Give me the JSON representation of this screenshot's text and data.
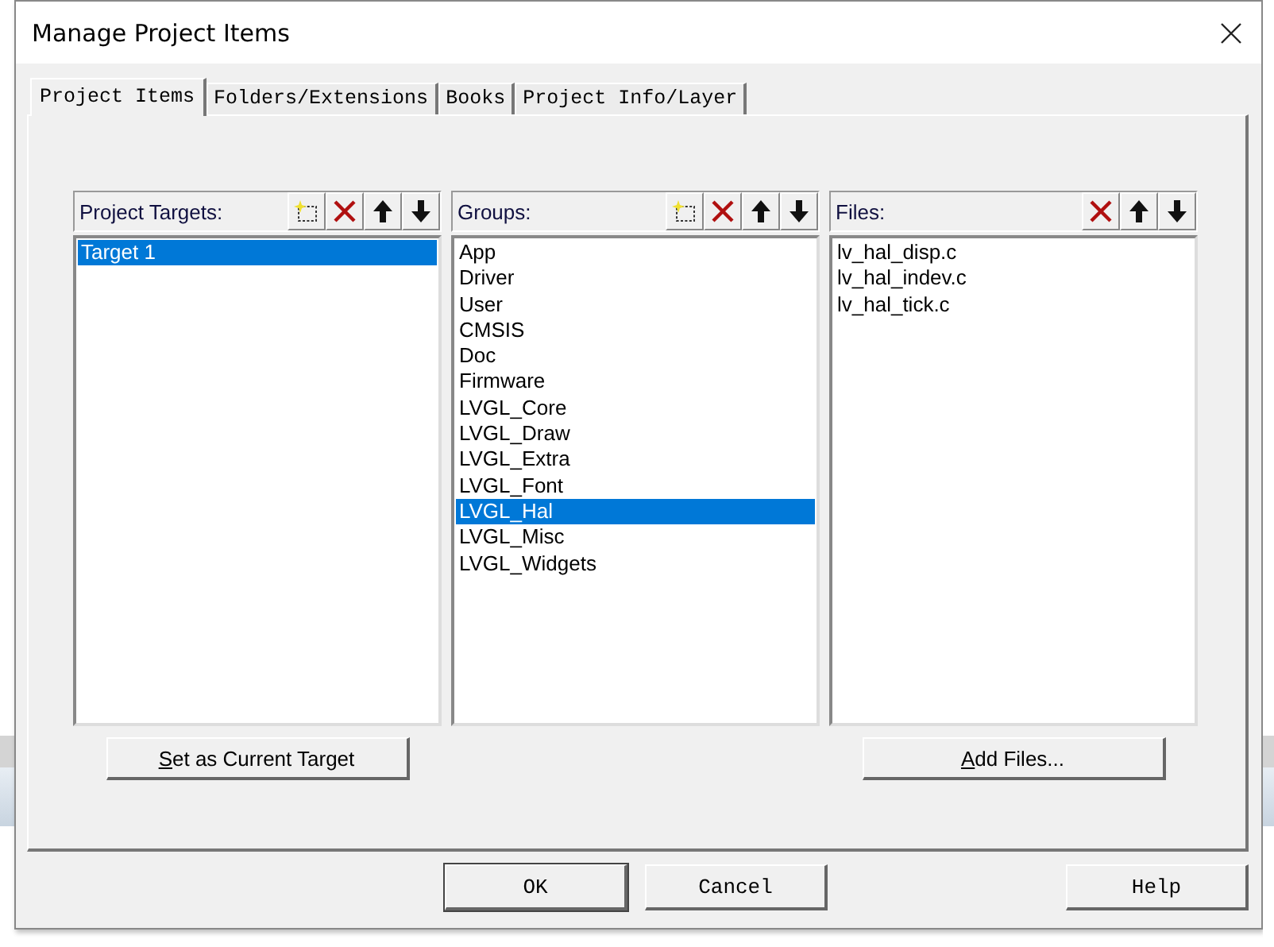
{
  "window": {
    "title": "Manage Project Items"
  },
  "tabs": [
    {
      "label": "Project Items",
      "selected": true
    },
    {
      "label": "Folders/Extensions",
      "selected": false
    },
    {
      "label": "Books",
      "selected": false
    },
    {
      "label": "Project Info/Layer",
      "selected": false
    }
  ],
  "panes": [
    {
      "title": "Project Targets:",
      "tools": [
        {
          "kind": "new"
        },
        {
          "kind": "delete"
        },
        {
          "kind": "up"
        },
        {
          "kind": "down"
        }
      ],
      "items": [
        {
          "label": "Target 1",
          "selected": true
        }
      ],
      "button": {
        "label": "Set as Current Target",
        "mnemonic_underlined": true
      }
    },
    {
      "title": "Groups:",
      "tools": [
        {
          "kind": "new"
        },
        {
          "kind": "delete"
        },
        {
          "kind": "up"
        },
        {
          "kind": "down"
        }
      ],
      "items": [
        {
          "label": "App",
          "selected": false
        },
        {
          "label": "Driver",
          "selected": false
        },
        {
          "label": "User",
          "selected": false
        },
        {
          "label": "CMSIS",
          "selected": false
        },
        {
          "label": "Doc",
          "selected": false
        },
        {
          "label": "Firmware",
          "selected": false
        },
        {
          "label": "LVGL_Core",
          "selected": false
        },
        {
          "label": "LVGL_Draw",
          "selected": false
        },
        {
          "label": "LVGL_Extra",
          "selected": false
        },
        {
          "label": "LVGL_Font",
          "selected": false
        },
        {
          "label": "LVGL_Hal",
          "selected": true
        },
        {
          "label": "LVGL_Misc",
          "selected": false
        },
        {
          "label": "LVGL_Widgets",
          "selected": false
        }
      ]
    },
    {
      "title": "Files:",
      "tools": [
        {
          "kind": "delete"
        },
        {
          "kind": "up"
        },
        {
          "kind": "down"
        }
      ],
      "items": [
        {
          "label": "lv_hal_disp.c",
          "selected": false
        },
        {
          "label": "lv_hal_indev.c",
          "selected": false
        },
        {
          "label": "lv_hal_tick.c",
          "selected": false
        }
      ],
      "button": {
        "label": "Add Files...",
        "mnemonic_underlined": true
      }
    }
  ],
  "buttons": [
    {
      "label": "OK",
      "kind": "ok",
      "default": true
    },
    {
      "label": "Cancel",
      "kind": "cancel",
      "default": false
    },
    {
      "label": "Help",
      "kind": "help",
      "default": false
    }
  ]
}
